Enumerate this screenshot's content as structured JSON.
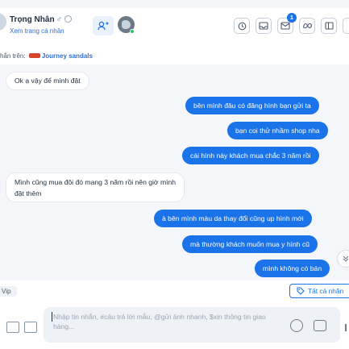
{
  "header": {
    "contact_name": "Trọng Nhân",
    "gender_symbol": "♂",
    "profile_link": "Xem trang cá nhân",
    "notification_count": "1"
  },
  "context": {
    "prefix": "hắn trên:",
    "product_name": "Journey sandals"
  },
  "messages": [
    {
      "side": "in",
      "text": "Ok ạ vậy để mình đặt"
    },
    {
      "side": "out",
      "text": "bên mình đâu có đăng hình bạn gửi ta"
    },
    {
      "side": "out",
      "text": "bạn coi thử nhầm shop nha"
    },
    {
      "side": "out",
      "text": "cái hình này khách mua chắc 3 năm rồi"
    },
    {
      "side": "in",
      "text": "Mình cũng mua đôi đó mang 3 năm rồi nên giờ mình",
      "text2": "đặt thêm"
    },
    {
      "side": "out",
      "text": "à bên mình màu da thay đổi cũng up hình mới"
    },
    {
      "side": "out",
      "text": "mà thường khách muốn mua y hình cũ"
    },
    {
      "side": "out",
      "text": "mình không có bán"
    }
  ],
  "tags": {
    "vip_label": "Vip",
    "all_tags_label": "Tất cả nhãn"
  },
  "composer": {
    "placeholder": "Nhập tin nhắn, #câu trả lời mẫu, @gửi ảnh nhanh, $xin thông tin giao hàng..."
  },
  "colors": {
    "accent": "#1a73e8",
    "chat_background": "#f4f6f9",
    "incoming_bubble": "#ffffff"
  },
  "icons": [
    "gender-male-icon",
    "globe-icon",
    "switch-user-icon",
    "group-avatar",
    "history-icon",
    "inbox-icon",
    "notification-icon",
    "meta-icon",
    "panel-icon",
    "image-icon",
    "emoji-icon",
    "template-icon",
    "tag-icon",
    "scroll-down-icon"
  ]
}
